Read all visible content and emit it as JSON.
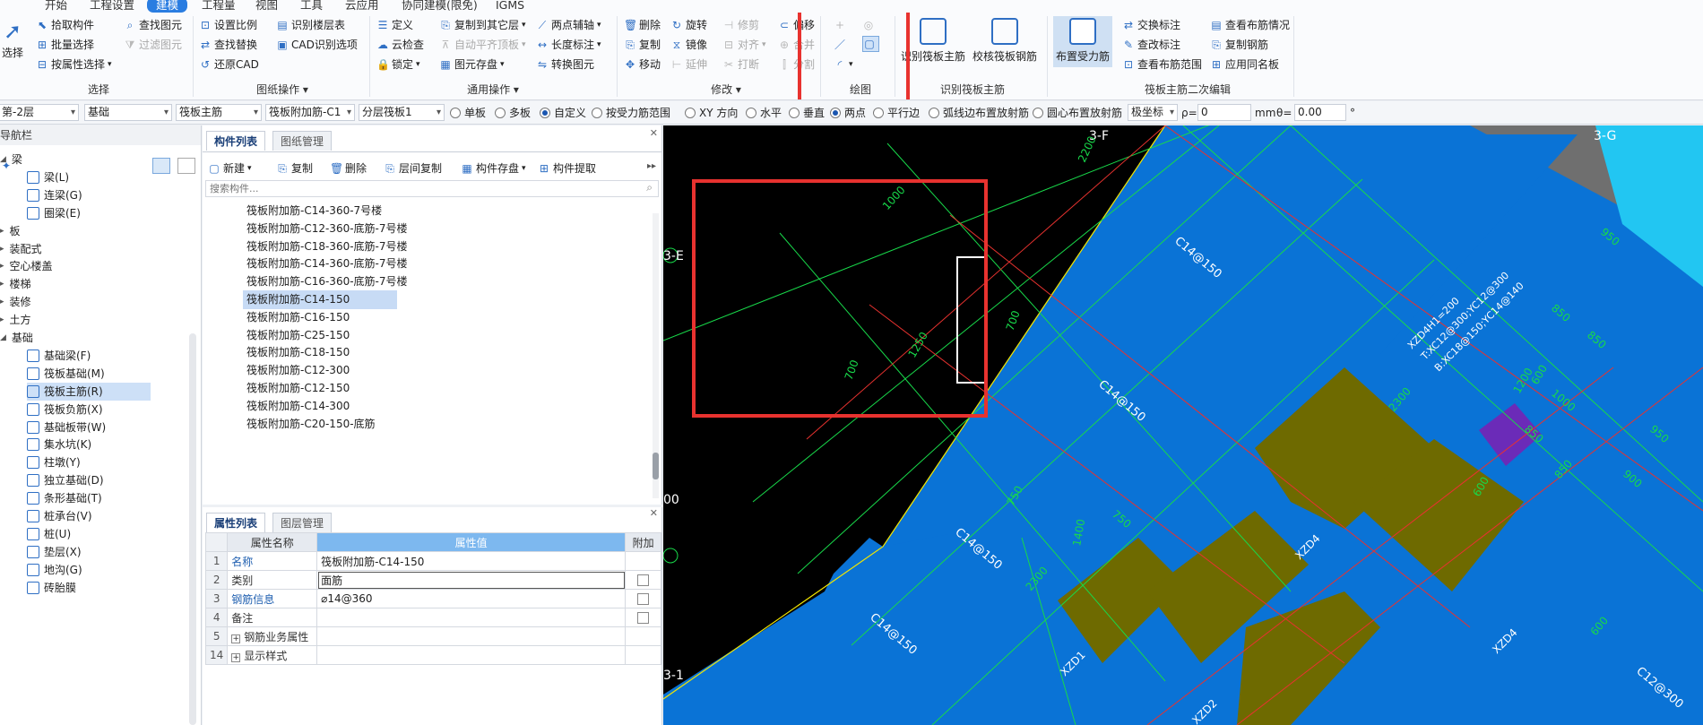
{
  "menu": {
    "tabs": [
      "开始",
      "工程设置",
      "建模",
      "工程量",
      "视图",
      "工具",
      "云应用",
      "协同建模(限免)",
      "IGMS"
    ],
    "active": "建模"
  },
  "ribbon": {
    "select_group": {
      "big_label": "选择",
      "items": [
        "拾取构件",
        "批量选择",
        "按属性选择",
        "查找图元",
        "过滤图元"
      ],
      "title": "选择"
    },
    "drawing_ops": {
      "items": [
        "设置比例",
        "识别楼层表",
        "查找替换",
        "CAD识别选项",
        "还原CAD"
      ],
      "title": "图纸操作"
    },
    "common_ops": {
      "items": [
        "定义",
        "复制到其它层",
        "两点辅轴",
        "云检查",
        "自动平齐顶板",
        "长度标注",
        "锁定",
        "图元存盘",
        "转换图元"
      ],
      "title": "通用操作"
    },
    "modify": {
      "items": [
        "删除",
        "旋转",
        "修剪",
        "偏移",
        "复制",
        "镜像",
        "对齐",
        "合并",
        "移动",
        "延伸",
        "打断",
        "分割"
      ],
      "title": "修改"
    },
    "draw": {
      "title": "绘图"
    },
    "identify": {
      "items": [
        "识别筏板主筋",
        "校核筏板钢筋"
      ],
      "title": "识别筏板主筋"
    },
    "secondary": {
      "big_label": "布置受力筋",
      "items": [
        "交换标注",
        "查看布筋情况",
        "查改标注",
        "复制钢筋",
        "查看布筋范围",
        "应用同名板"
      ],
      "title": "筏板主筋二次编辑"
    }
  },
  "options": {
    "floor": "第-2层",
    "category": "基础",
    "type": "筏板主筋",
    "component": "筏板附加筋-C1",
    "raft": "分层筏板1",
    "radios": [
      "单板",
      "多板",
      "自定义",
      "按受力筋范围",
      "XY 方向",
      "水平",
      "垂直",
      "两点",
      "平行边",
      "弧线边布置放射筋",
      "圆心布置放射筋"
    ],
    "active_radios": [
      "自定义",
      "两点"
    ],
    "coord_label": "极坐标",
    "rho_label": "ρ=",
    "rho_value": "0",
    "mm_label": "mm",
    "theta_label": "θ=",
    "theta_value": "0.00",
    "deg_label": "°"
  },
  "nav": {
    "title": "导航栏",
    "items": [
      {
        "label": "梁",
        "level": 0,
        "expanded": true
      },
      {
        "label": "梁(L)",
        "level": 1
      },
      {
        "label": "连梁(G)",
        "level": 1
      },
      {
        "label": "圈梁(E)",
        "level": 1
      },
      {
        "label": "板",
        "level": 0
      },
      {
        "label": "装配式",
        "level": 0
      },
      {
        "label": "空心楼盖",
        "level": 0
      },
      {
        "label": "楼梯",
        "level": 0
      },
      {
        "label": "装修",
        "level": 0
      },
      {
        "label": "土方",
        "level": 0
      },
      {
        "label": "基础",
        "level": 0,
        "expanded": true
      },
      {
        "label": "基础梁(F)",
        "level": 1
      },
      {
        "label": "筏板基础(M)",
        "level": 1
      },
      {
        "label": "筏板主筋(R)",
        "level": 1,
        "selected": true
      },
      {
        "label": "筏板负筋(X)",
        "level": 1
      },
      {
        "label": "基础板带(W)",
        "level": 1
      },
      {
        "label": "集水坑(K)",
        "level": 1
      },
      {
        "label": "柱墩(Y)",
        "level": 1
      },
      {
        "label": "独立基础(D)",
        "level": 1
      },
      {
        "label": "条形基础(T)",
        "level": 1
      },
      {
        "label": "桩承台(V)",
        "level": 1
      },
      {
        "label": "桩(U)",
        "level": 1
      },
      {
        "label": "垫层(X)",
        "level": 1
      },
      {
        "label": "地沟(G)",
        "level": 1
      },
      {
        "label": "砖胎膜",
        "level": 1
      }
    ]
  },
  "components": {
    "tabs": [
      "构件列表",
      "图纸管理"
    ],
    "toolbar": [
      "新建",
      "复制",
      "删除",
      "层间复制",
      "构件存盘",
      "构件提取"
    ],
    "search_placeholder": "搜索构件...",
    "items": [
      "筏板附加筋-C14-360-7号楼",
      "筏板附加筋-C12-360-底筋-7号楼",
      "筏板附加筋-C18-360-底筋-7号楼",
      "筏板附加筋-C14-360-底筋-7号楼",
      "筏板附加筋-C16-360-底筋-7号楼",
      "筏板附加筋-C14-150",
      "筏板附加筋-C16-150",
      "筏板附加筋-C25-150",
      "筏板附加筋-C18-150",
      "筏板附加筋-C12-300",
      "筏板附加筋-C12-150",
      "筏板附加筋-C14-300",
      "筏板附加筋-C20-150-底筋"
    ],
    "selected_index": 5
  },
  "properties": {
    "tabs": [
      "属性列表",
      "图层管理"
    ],
    "headers": [
      "属性名称",
      "属性值",
      "附加"
    ],
    "rows": [
      {
        "num": "1",
        "name": "名称",
        "value": "筏板附加筋-C14-150",
        "blue": true,
        "check": false
      },
      {
        "num": "2",
        "name": "类别",
        "value": "面筋",
        "blue": false,
        "check": true
      },
      {
        "num": "3",
        "name": "钢筋信息",
        "value": "⌀14@360",
        "blue": true,
        "check": true
      },
      {
        "num": "4",
        "name": "备注",
        "value": "",
        "blue": false,
        "check": true
      },
      {
        "num": "5",
        "name": "钢筋业务属性",
        "value": "",
        "blue": false,
        "check": false,
        "expand": true
      },
      {
        "num": "14",
        "name": "显示样式",
        "value": "",
        "blue": false,
        "check": false,
        "expand": true
      }
    ]
  },
  "canvas": {
    "axis_labels": [
      "3-F",
      "3-G",
      "3-E",
      "3-1"
    ],
    "dims": [
      "1000",
      "2200",
      "1250",
      "700",
      "700",
      "950",
      "850",
      "850",
      "1200",
      "600",
      "1000",
      "850",
      "2300",
      "850",
      "600",
      "950",
      "900",
      "750",
      "750",
      "1400",
      "2300",
      "600"
    ],
    "rebar_labels": [
      "C14@150",
      "C14@150",
      "C14@150",
      "C14@150",
      "C12@300"
    ],
    "zones": [
      "XZD4",
      "XZD4",
      "XZD1",
      "XZD2"
    ],
    "annotation": [
      "XZD4H1=200",
      "T:XC12@300;YC12@300",
      "B:XC18@150;YC14@140"
    ],
    "partial_left": "00",
    "colors": {
      "slab": "#0a73d6",
      "black": "#000000",
      "olive": "#6e6a00",
      "purple": "#6b2bb8",
      "gray": "#6f6f6f",
      "green": "#18d94a",
      "red": "#e8322f",
      "cyan": "#22c6f2",
      "yellow": "#f2e600"
    }
  }
}
